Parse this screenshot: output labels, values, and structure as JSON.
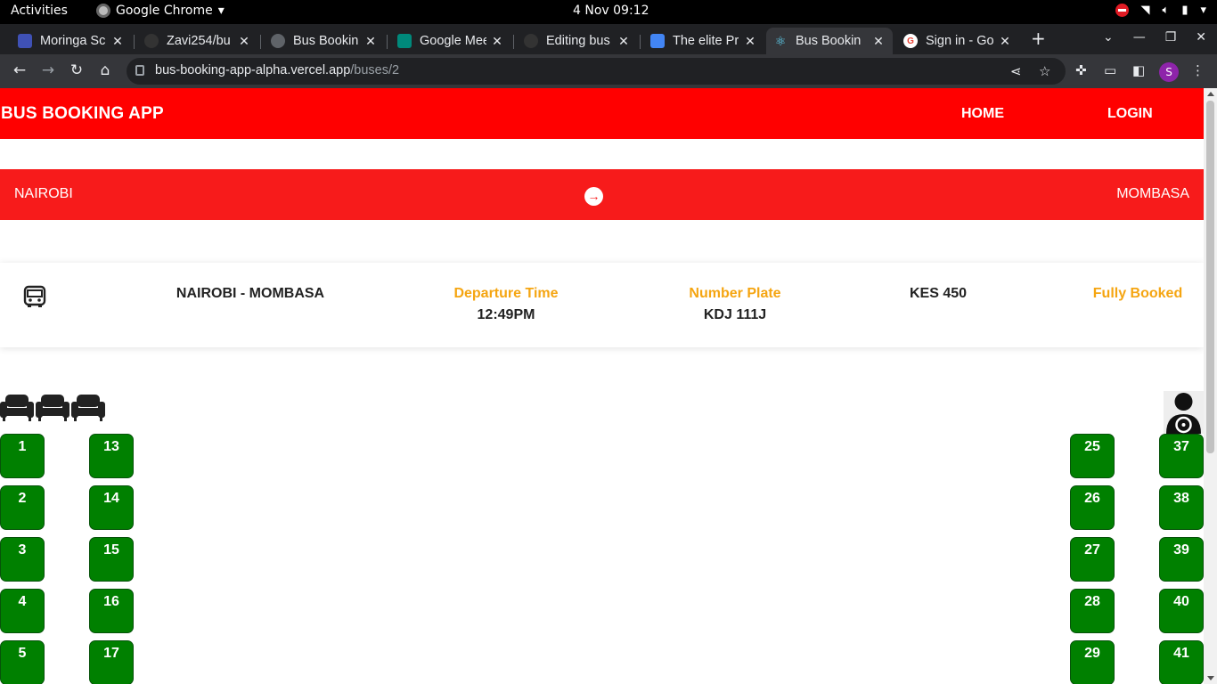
{
  "system_bar": {
    "activities": "Activities",
    "app_name": "Google Chrome",
    "clock": "4 Nov  09:12"
  },
  "tabs": [
    {
      "title": "Moringa Sc",
      "icon": "moringa-icon",
      "color": "#3f51b5",
      "active": false
    },
    {
      "title": "Zavi254/bu",
      "icon": "github-icon",
      "color": "#333333",
      "active": false
    },
    {
      "title": "Bus Bookin",
      "icon": "globe-icon",
      "color": "#5f6368",
      "active": false
    },
    {
      "title": "Google Mee",
      "icon": "meet-icon",
      "color": "#00897b",
      "active": false
    },
    {
      "title": "Editing bus",
      "icon": "github-icon",
      "color": "#333333",
      "active": false
    },
    {
      "title": "The elite Pr",
      "icon": "docs-icon",
      "color": "#4285f4",
      "active": false
    },
    {
      "title": "Bus Bookin",
      "icon": "react-icon",
      "color": "#61dafb",
      "active": true
    },
    {
      "title": "Sign in - Go",
      "icon": "google-icon",
      "color": "#ea4335",
      "active": false
    }
  ],
  "address_bar": {
    "host": "bus-booking-app-alpha.vercel.app",
    "path": "/buses/2"
  },
  "profile_initial": "S",
  "app": {
    "brand": "BUS BOOKING APP",
    "nav": {
      "home": "HOME",
      "login": "LOGIN"
    },
    "route": {
      "from": "NAIROBI",
      "to": "MOMBASA"
    },
    "bus": {
      "route": "NAIROBI - MOMBASA",
      "departure_label": "Departure Time",
      "departure_time": "12:49PM",
      "plate_label": "Number Plate",
      "plate": "KDJ 111J",
      "price": "KES 450",
      "status": "Fully Booked"
    },
    "seats": {
      "left_col_a": [
        "1",
        "2",
        "3",
        "4",
        "5"
      ],
      "left_col_b": [
        "13",
        "14",
        "15",
        "16",
        "17"
      ],
      "right_col_a": [
        "25",
        "26",
        "27",
        "28",
        "29"
      ],
      "right_col_b": [
        "37",
        "38",
        "39",
        "40",
        "41"
      ]
    }
  },
  "colors": {
    "nav_red": "#ff0000",
    "route_red": "#f71b1b",
    "accent_orange": "#f5a511",
    "seat_green": "#008000"
  }
}
